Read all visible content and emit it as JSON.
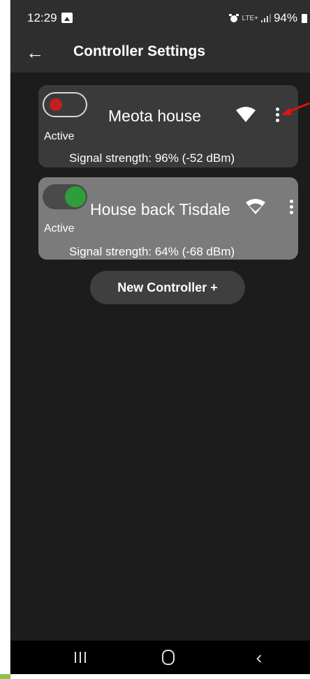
{
  "status_bar": {
    "time": "12:29",
    "network": "LTE+",
    "battery": "94%"
  },
  "app_bar": {
    "title": "Controller Settings"
  },
  "controllers": [
    {
      "name": "Meota house",
      "status": "Active",
      "toggle_on": false,
      "signal": "Signal strength: 96% (-52 dBm)"
    },
    {
      "name": "House back Tisdale",
      "status": "Active",
      "toggle_on": true,
      "signal": "Signal strength: 64% (-68 dBm)"
    }
  ],
  "new_controller_button": "New Controller +",
  "colors": {
    "toggle_off_knob": "#c41e1e",
    "toggle_on_knob": "#2e9e3a",
    "annotation_arrow": "#e01010"
  }
}
